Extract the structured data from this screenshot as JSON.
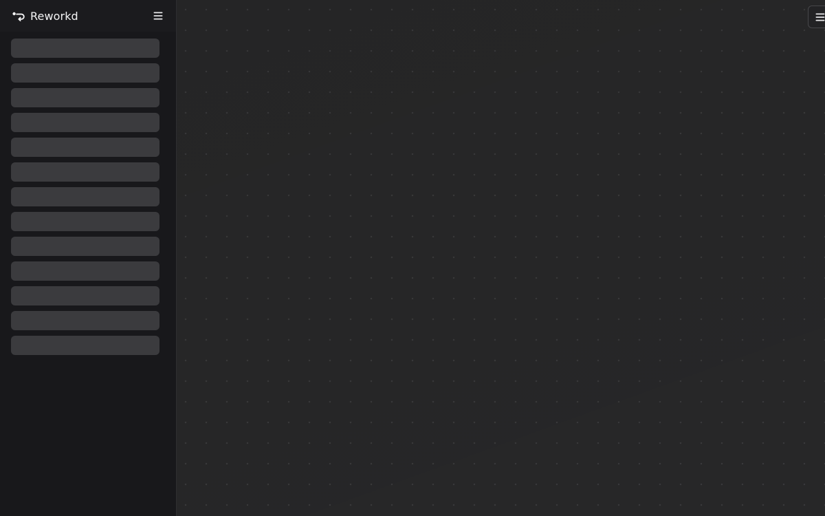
{
  "sidebar": {
    "brand": {
      "name": "Reworkd",
      "logo_icon": "reworkd-logo-icon"
    },
    "toggle_icon": "hamburger-menu-icon",
    "skeleton_count": 13
  },
  "main": {
    "menu_icon": "hamburger-menu-icon"
  },
  "colors": {
    "sidebar_bg": "#18181b",
    "main_bg": "#272728",
    "skeleton": "#3b3b3e",
    "text": "#f4f4f5"
  }
}
